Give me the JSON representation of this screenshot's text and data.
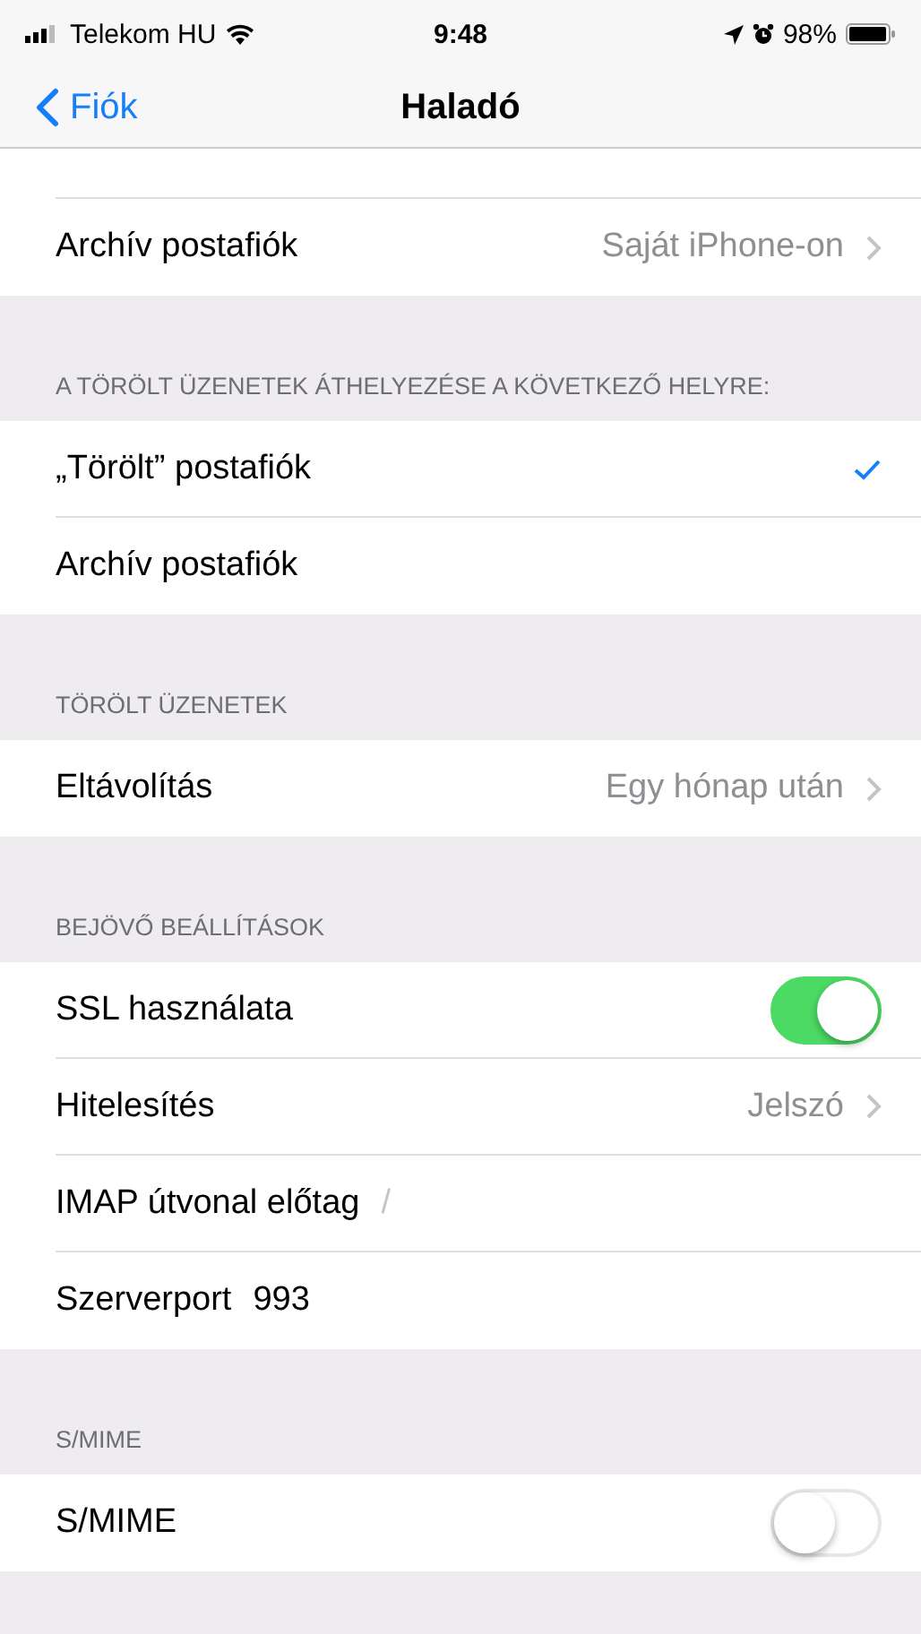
{
  "status_bar": {
    "carrier": "Telekom HU",
    "time": "9:48",
    "battery": "98%"
  },
  "nav": {
    "back": "Fiók",
    "title": "Haladó"
  },
  "sections": [
    {
      "rows": [
        {
          "kind": "detail",
          "label": "Archív postafiók",
          "value": "Saját iPhone-on"
        }
      ]
    },
    {
      "header": "A TÖRÖLT ÜZENETEK ÁTHELYEZÉSE A KÖVETKEZŐ HELYRE:",
      "rows": [
        {
          "kind": "check",
          "label": "„Törölt” postafiók",
          "checked": true
        },
        {
          "kind": "check",
          "label": "Archív postafiók",
          "checked": false
        }
      ]
    },
    {
      "header": "TÖRÖLT ÜZENETEK",
      "rows": [
        {
          "kind": "detail",
          "label": "Eltávolítás",
          "value": "Egy hónap után"
        }
      ]
    },
    {
      "header": "BEJÖVŐ BEÁLLÍTÁSOK",
      "rows": [
        {
          "kind": "toggle",
          "label": "SSL használata",
          "on": true
        },
        {
          "kind": "detail",
          "label": "Hitelesítés",
          "value": "Jelszó"
        },
        {
          "kind": "field",
          "label": "IMAP útvonal előtag",
          "placeholder": "/"
        },
        {
          "kind": "field",
          "label": "Szerverport",
          "value": "993"
        }
      ]
    },
    {
      "header": "S/MIME",
      "rows": [
        {
          "kind": "toggle",
          "label": "S/MIME",
          "on": false
        }
      ]
    }
  ]
}
